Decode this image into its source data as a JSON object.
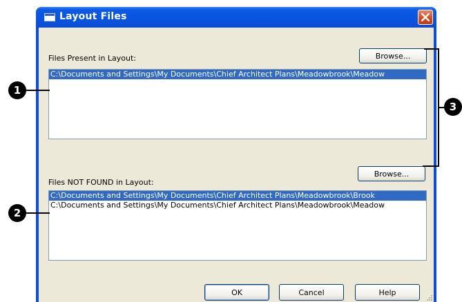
{
  "window": {
    "title": "Layout  Files"
  },
  "present": {
    "label": "Files Present in Layout:",
    "browse_label": "Browse...",
    "files": [
      "C:\\Documents and Settings\\My Documents\\Chief Architect Plans\\Meadowbrook\\Meadow"
    ]
  },
  "notfound": {
    "label": "Files NOT FOUND in Layout:",
    "browse_label": "Browse...",
    "files": [
      "C:\\Documents and Settings\\My Documents\\Chief Architect Plans\\Meadowbrook\\Brook",
      "C:\\Documents and Settings\\My Documents\\Chief Architect Plans\\Meadowbrook\\Meadow"
    ]
  },
  "buttons": {
    "ok": "OK",
    "cancel": "Cancel",
    "help": "Help"
  },
  "callouts": [
    "1",
    "2",
    "3"
  ],
  "colors": {
    "titlebar": "#0a4fd9",
    "dialog_bg": "#ece9d8",
    "selection": "#316ac5",
    "close": "#d84b1f"
  }
}
